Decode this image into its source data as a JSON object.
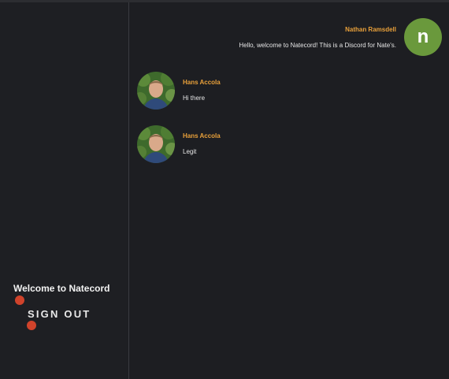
{
  "sidebar": {
    "welcome_text": "Welcome to Natecord",
    "sign_out_label": "SIGN OUT"
  },
  "messages": [
    {
      "author": "Nathan Ramsdell",
      "avatar_letter": "n",
      "avatar_color": "#6a993c",
      "text": "Hello, welcome to Natecord! This is a Discord for Nate's.",
      "side": "right"
    },
    {
      "author": "Hans Accola",
      "avatar": "profile-photo",
      "text": "Hi there",
      "side": "left"
    },
    {
      "author": "Hans Accola",
      "avatar": "profile-photo",
      "text": "Legit",
      "side": "left"
    }
  ],
  "colors": {
    "background": "#1c1d21",
    "accent_author": "#e8a03a",
    "sign_out_dot": "#d0432b"
  }
}
